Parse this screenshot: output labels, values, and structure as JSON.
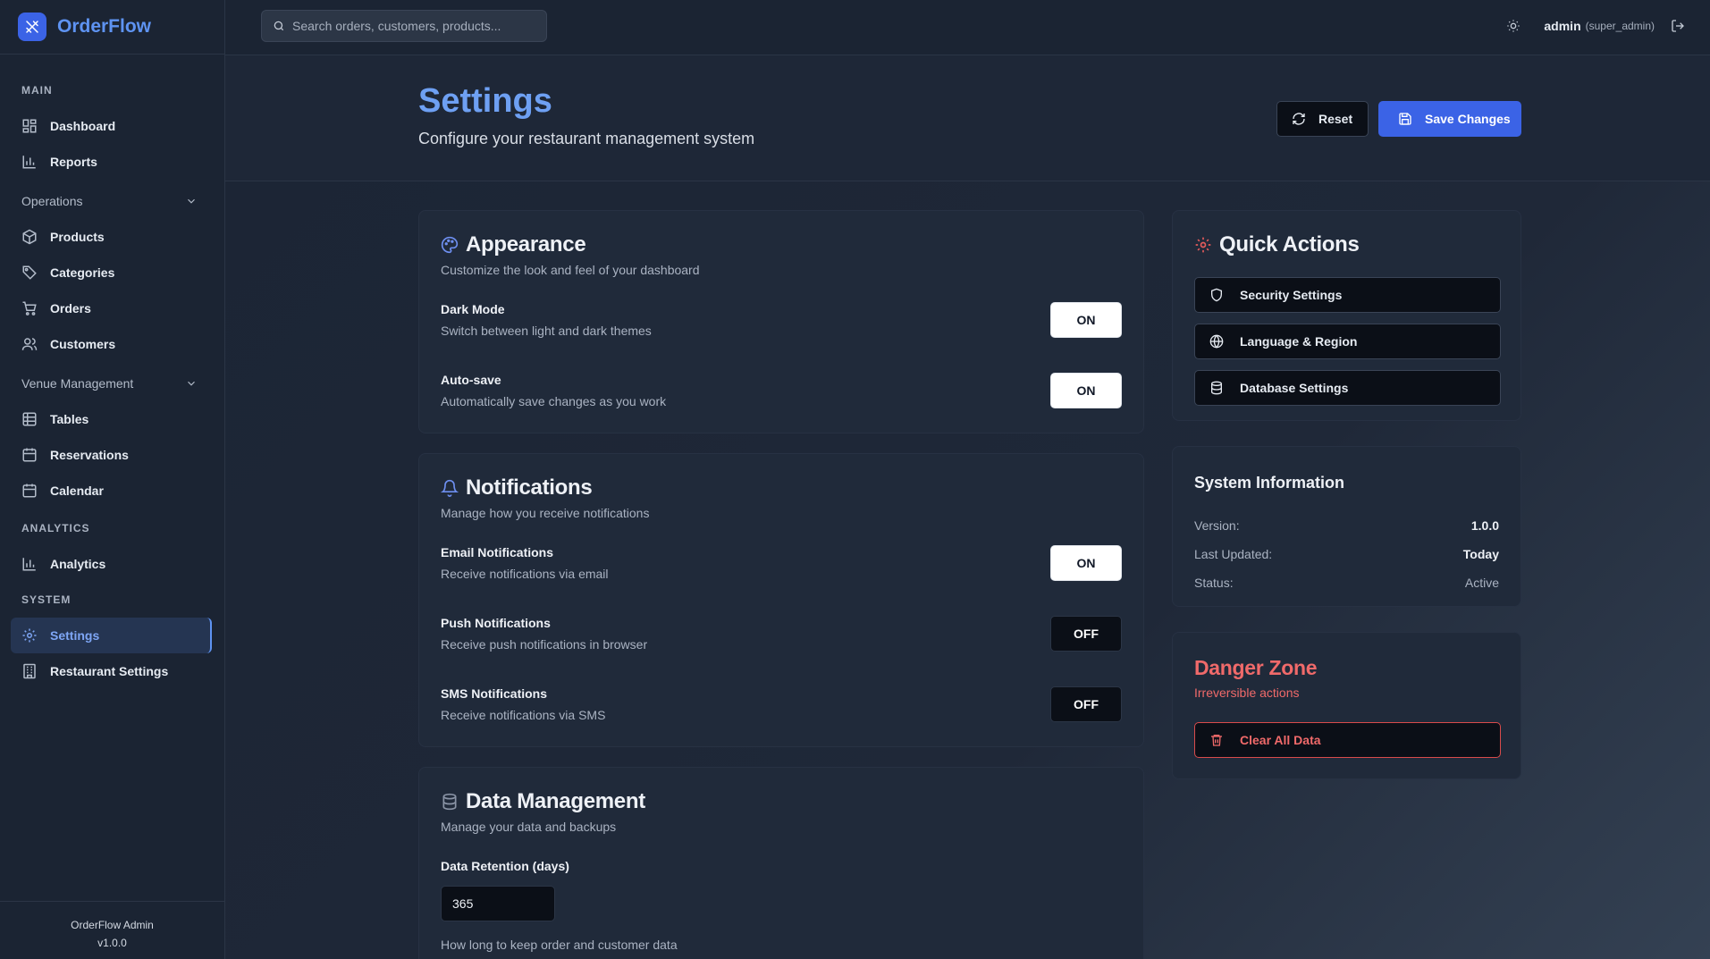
{
  "brand": {
    "name": "OrderFlow"
  },
  "search": {
    "placeholder": "Search orders, customers, products..."
  },
  "user": {
    "name": "admin",
    "role": "(super_admin)"
  },
  "sidebar": {
    "main_label": "MAIN",
    "dashboard": "Dashboard",
    "reports": "Reports",
    "operations_label": "Operations",
    "products": "Products",
    "categories": "Categories",
    "orders": "Orders",
    "customers": "Customers",
    "venue_label": "Venue Management",
    "tables": "Tables",
    "reservations": "Reservations",
    "calendar": "Calendar",
    "analytics_label": "ANALYTICS",
    "analytics": "Analytics",
    "system_label": "SYSTEM",
    "settings": "Settings",
    "restaurant_settings": "Restaurant Settings",
    "footer_name": "OrderFlow Admin",
    "footer_version": "v1.0.0"
  },
  "header": {
    "title": "Settings",
    "subtitle": "Configure your restaurant management system",
    "reset_label": "Reset",
    "save_label": "Save Changes"
  },
  "appearance": {
    "title": "Appearance",
    "desc": "Customize the look and feel of your dashboard",
    "dark_mode": {
      "label": "Dark Mode",
      "desc": "Switch between light and dark themes",
      "state": "ON"
    },
    "auto_save": {
      "label": "Auto-save",
      "desc": "Automatically save changes as you work",
      "state": "ON"
    }
  },
  "notifications": {
    "title": "Notifications",
    "desc": "Manage how you receive notifications",
    "email": {
      "label": "Email Notifications",
      "desc": "Receive notifications via email",
      "state": "ON"
    },
    "push": {
      "label": "Push Notifications",
      "desc": "Receive push notifications in browser",
      "state": "OFF"
    },
    "sms": {
      "label": "SMS Notifications",
      "desc": "Receive notifications via SMS",
      "state": "OFF"
    }
  },
  "data_management": {
    "title": "Data Management",
    "desc": "Manage your data and backups",
    "retention_label": "Data Retention (days)",
    "retention_value": "365",
    "retention_help": "How long to keep order and customer data"
  },
  "quick_actions": {
    "title": "Quick Actions",
    "security": "Security Settings",
    "language": "Language & Region",
    "database": "Database Settings"
  },
  "system_info": {
    "title": "System Information",
    "version_key": "Version:",
    "version_val": "1.0.0",
    "updated_key": "Last Updated:",
    "updated_val": "Today",
    "status_key": "Status:",
    "status_val": "Active"
  },
  "danger_zone": {
    "title": "Danger Zone",
    "desc": "Irreversible actions",
    "clear_label": "Clear All Data"
  },
  "colors": {
    "accent": "#3b63e6",
    "title_blue": "#6ea0f3",
    "danger": "#f06a6a",
    "background": "#1c2535"
  }
}
